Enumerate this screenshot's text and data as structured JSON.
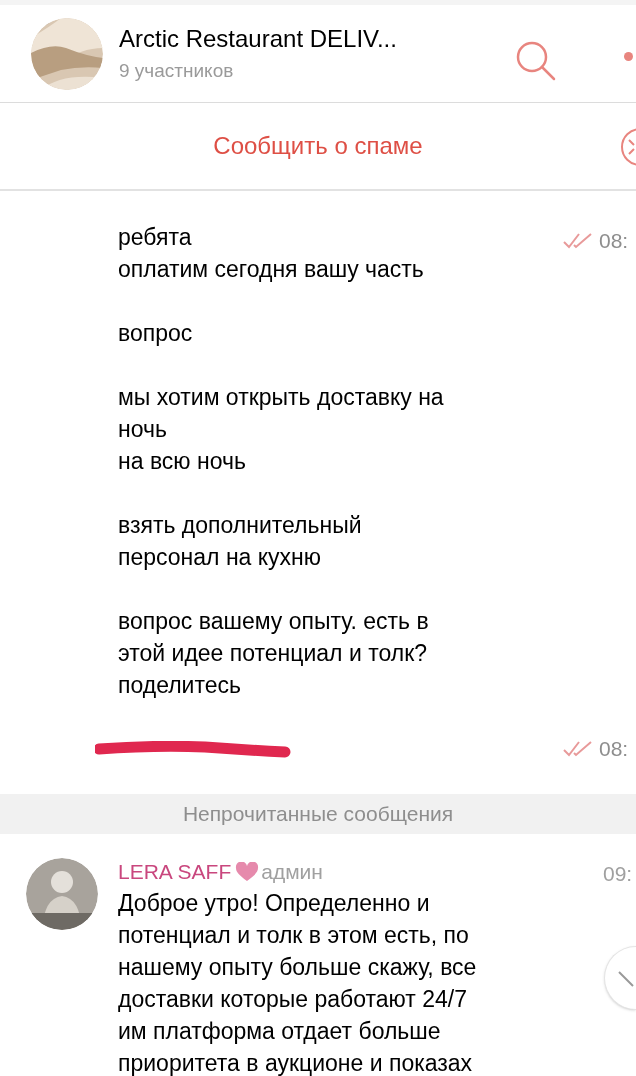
{
  "header": {
    "title": "Arctic Restaurant DELIV...",
    "subtitle": "9 участников"
  },
  "spam_bar": {
    "label": "Сообщить о спаме"
  },
  "messages": [
    {
      "kind": "outgoing",
      "text": "ребята\nоплатим сегодня вашу часть\n\nвопрос\n\nмы хотим открыть доставку на\nночь\nна всю ночь\n\nвзять дополнительный\nперсонал на кухню\n\nвопрос вашему опыту. есть в\nэтой идее потенциал и толк?\nподелитесь",
      "time": "08:",
      "read": true
    },
    {
      "kind": "outgoing",
      "redacted": true,
      "time": "08:",
      "read": true
    },
    {
      "kind": "divider",
      "label": "Непрочитанные сообщения"
    },
    {
      "kind": "incoming",
      "author": "LERA SAFF",
      "color": "#c9477e",
      "heart": true,
      "role": "админ",
      "time": "09:",
      "text": "Доброе утро! Определенно и\nпотенциал и толк в этом есть, по\nнашему опыту больше скажу, все\nдоставки которые работают 24/7\nим платформа отдает больше\nприоритета в аукционе и показах"
    }
  ]
}
